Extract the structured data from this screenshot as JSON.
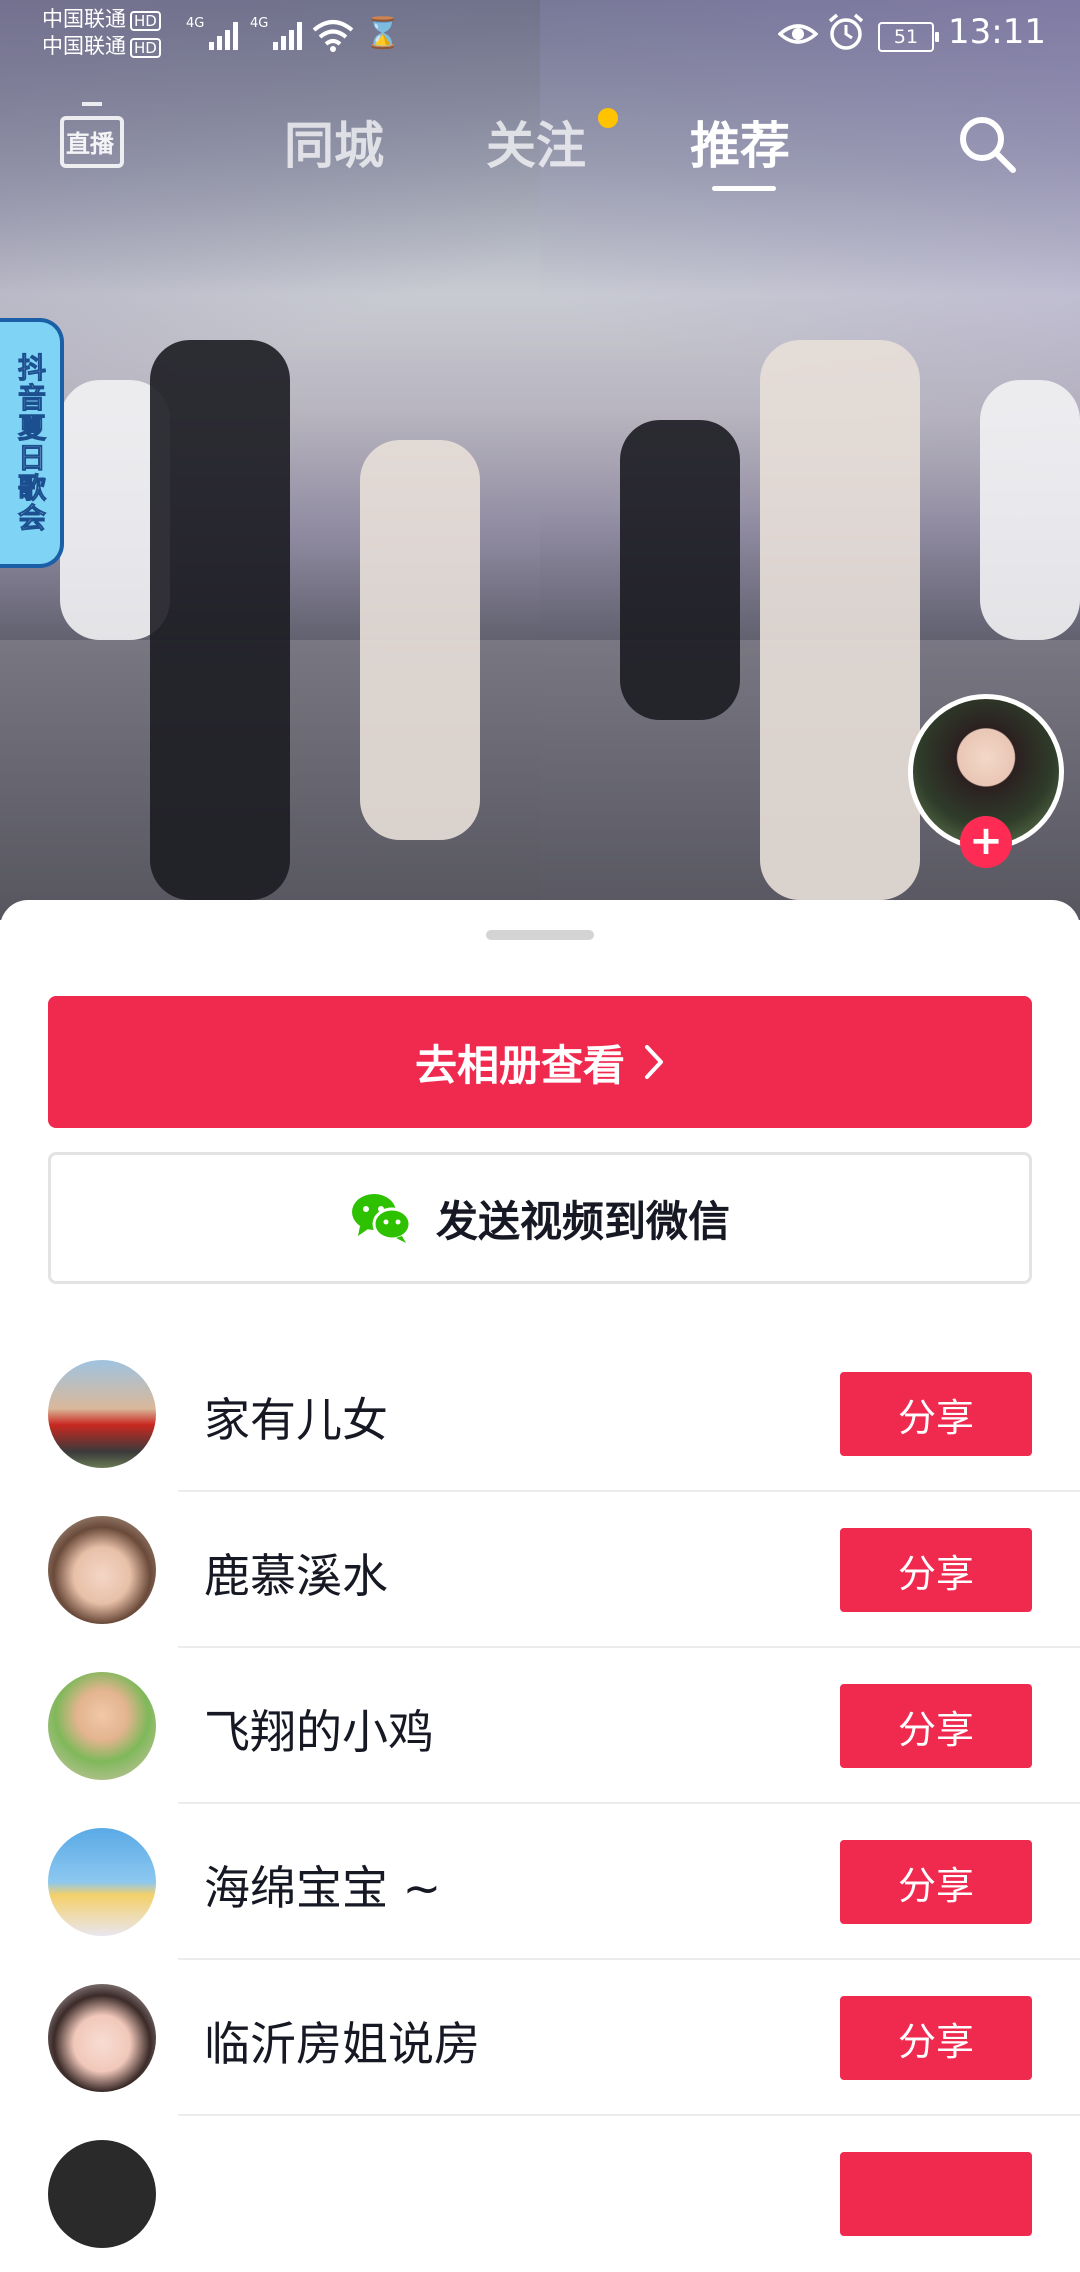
{
  "status_bar": {
    "carrier1": "中国联通",
    "carrier2": "中国联通",
    "hd_label": "HD",
    "network1": "4G",
    "network2": "4G",
    "battery": "51",
    "time": "13:11"
  },
  "top_nav": {
    "live_label": "直播",
    "tabs": [
      {
        "label": "同城"
      },
      {
        "label": "关注"
      },
      {
        "label": "推荐"
      }
    ],
    "active_tab": "推荐",
    "follow_dot_color": "#ffc300"
  },
  "event_badge": "抖音夏日歌会",
  "sheet": {
    "album_button": "去相册查看",
    "wechat_button": "发送视频到微信",
    "share_label": "分享",
    "contacts": [
      {
        "name": "家有儿女"
      },
      {
        "name": "鹿慕溪水"
      },
      {
        "name": "飞翔的小鸡"
      },
      {
        "name": "海绵宝宝 ~"
      },
      {
        "name": "临沂房姐说房"
      }
    ]
  },
  "colors": {
    "accent": "#f0294f",
    "wechat_green": "#2dc100",
    "text_dark": "#161823"
  }
}
